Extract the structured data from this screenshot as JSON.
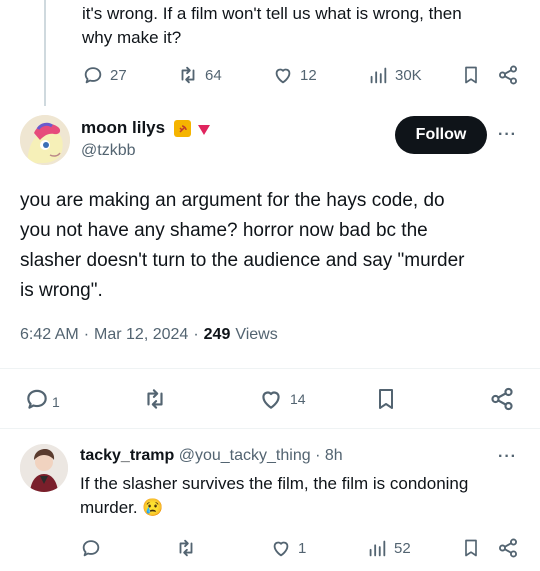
{
  "prev_tweet": {
    "line1": "it's wrong. If a film won't tell us what is wrong, then",
    "line2": "why make it?",
    "actions": {
      "replies": "27",
      "retweets": "64",
      "likes": "12",
      "views": "30K"
    }
  },
  "main_tweet": {
    "display_name": "moon lilys",
    "handle": "@tzkbb",
    "follow_label": "Follow",
    "more": "···",
    "text_lines": [
      "you are making an argument for the hays code, do",
      "you not have any shame? horror now bad bc the",
      "slasher doesn't turn to the audience and say \"murder",
      "is wrong\"."
    ],
    "meta": {
      "time": "6:42 AM",
      "sep1": "·",
      "date": "Mar 12, 2024",
      "sep2": "·",
      "views_count": "249",
      "views_label": "Views"
    },
    "actions": {
      "replies": "1",
      "likes": "14"
    }
  },
  "reply": {
    "display_name": "tacky_tramp",
    "handle": "@you_tacky_thing",
    "time": "· 8h",
    "more": "···",
    "line1": "If the slasher survives the film, the film is condoning",
    "line2": "murder. 😢",
    "actions": {
      "likes": "1",
      "views": "52"
    }
  },
  "colors": {
    "text": "#0f1419",
    "muted": "#536471",
    "divider": "#eff3f4",
    "follow_bg": "#0f1419",
    "badge_red": "#e0245e",
    "badge_gold": "#f5b400"
  },
  "icons": [
    "reply-icon",
    "retweet-icon",
    "like-icon",
    "views-icon",
    "bookmark-icon",
    "share-icon",
    "more-icon",
    "country-flag-icon",
    "triangle-badge-icon"
  ]
}
